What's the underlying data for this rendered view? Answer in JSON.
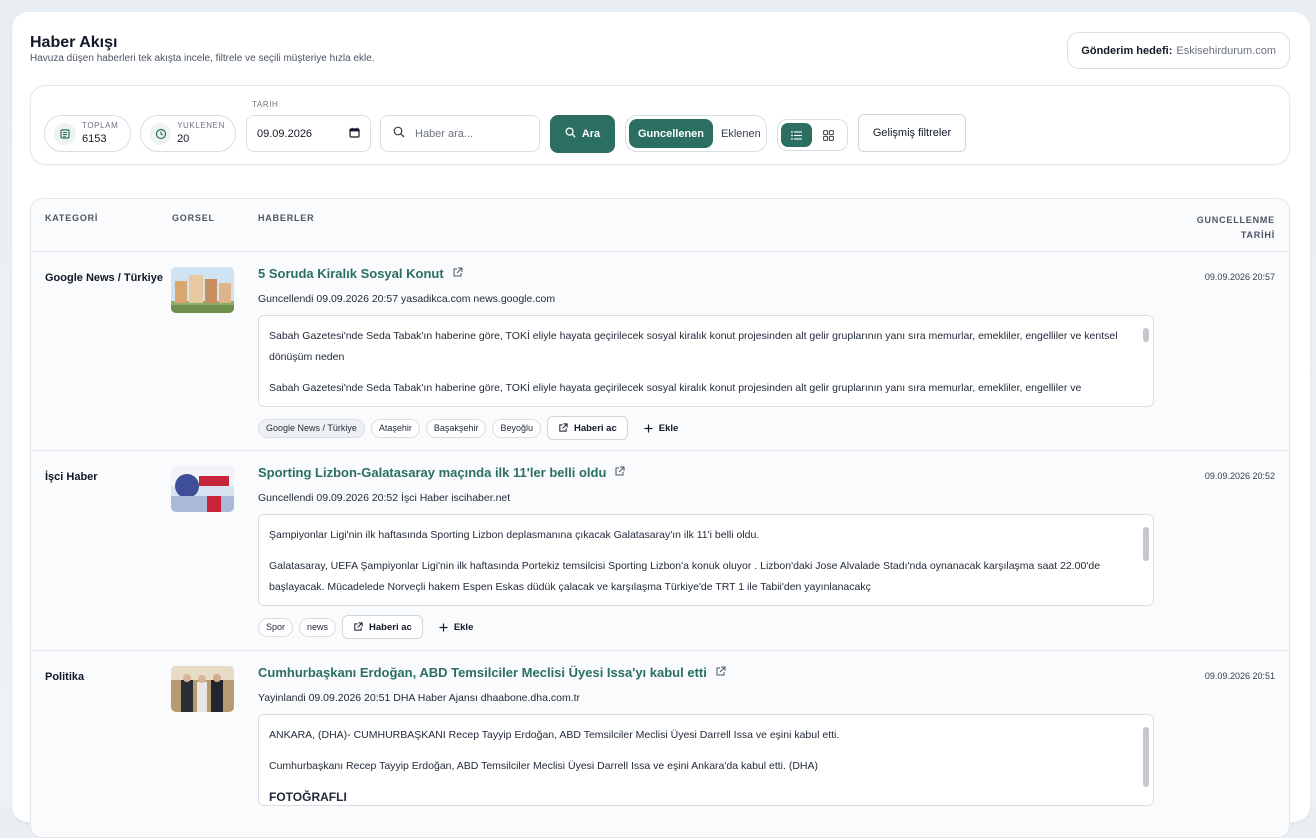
{
  "header": {
    "title": "Haber Akışı",
    "subtitle": "Havuza düşen haberleri tek akışta incele, filtrele ve seçili müşteriye hızla ekle.",
    "target_label": "Gönderim hedefi:",
    "target_value": "Eskisehirdurum.com"
  },
  "toolbar": {
    "total_label": "TOPLAM",
    "total_value": "6153",
    "loaded_label": "YUKLENEN",
    "loaded_value": "20",
    "date_label": "TARİH",
    "date_value": "09.09.2026",
    "search_placeholder": "Haber ara...",
    "search_button": "Ara",
    "sort_active": "Guncellenen",
    "sort_inactive": "Eklenen",
    "advanced_filters": "Gelişmiş filtreler"
  },
  "table": {
    "headers": {
      "category": "KATEGORİ",
      "image": "GORSEL",
      "news": "HABERLER",
      "updated_line1": "GUNCELLENME",
      "updated_line2": "TARİHİ"
    },
    "open_label": "Haberi ac",
    "add_label": "Ekle",
    "rows": [
      {
        "category": "Google News / Türkiye",
        "title": "5 Soruda Kiralık Sosyal Konut",
        "meta": "Guncellendi 09.09.2026 20:57 yasadikca.com news.google.com",
        "paragraphs": [
          "Sabah Gazetesi'nde Seda Tabak'ın haberine göre, TOKİ eliyle hayata geçirilecek sosyal kiralık konut projesinden alt gelir gruplarının yanı sıra memurlar, emekliler, engelliler ve kentsel dönüşüm neden",
          "Sabah Gazetesi'nde Seda Tabak'ın haberine göre, TOKİ eliyle hayata geçirilecek sosyal kiralık konut projesinden alt gelir gruplarının yanı sıra memurlar, emekliler, engelliler ve"
        ],
        "date": "09.09.2026 20:57",
        "tags": [
          "Google News / Türkiye",
          "Ataşehir",
          "Başakşehir",
          "Beyoğlu"
        ]
      },
      {
        "category": "İşci Haber",
        "title": "Sporting Lizbon-Galatasaray maçında ilk 11'ler belli oldu",
        "meta": "Guncellendi 09.09.2026 20:52 İşci Haber iscihaber.net",
        "paragraphs": [
          "Şampiyonlar Ligi'nin ilk haftasında Sporting Lizbon deplasmanına çıkacak Galatasaray'ın ilk 11'i belli oldu.",
          "Galatasaray, UEFA Şampiyonlar Ligi'nin ilk haftasında Portekiz temsilcisi Sporting Lizbon'a konuk oluyor . Lizbon'daki Jose Alvalade Stadı'nda oynanacak karşılaşma saat 22.00'de başlayacak. Mücadelede Norveçli hakem Espen Eskas düdük çalacak ve karşılaşma Türkiye'de TRT 1 ile Tabii'den yayınlanacakç"
        ],
        "date": "09.09.2026 20:52",
        "tags": [
          "Spor",
          "news"
        ]
      },
      {
        "category": "Politika",
        "title": "Cumhurbaşkanı Erdoğan, ABD Temsilciler Meclisi Üyesi Issa'yı kabul etti",
        "meta": "Yayinlandi 09.09.2026 20:51 DHA Haber Ajansı dhaabone.dha.com.tr",
        "paragraphs": [
          "ANKARA, (DHA)- CUMHURBAŞKANI Recep Tayyip Erdoğan, ABD Temsilciler Meclisi Üyesi Darrell Issa ve eşini kabul etti.",
          "Cumhurbaşkanı Recep Tayyip Erdoğan, ABD Temsilciler Meclisi Üyesi Darrell Issa ve eşini Ankara'da kabul etti. (DHA)"
        ],
        "strong_line": "FOTOĞRAFLI",
        "date": "09.09.2026 20:51",
        "tags": []
      }
    ]
  },
  "colors": {
    "accent": "#2a6f61",
    "border": "#d9dee5"
  }
}
